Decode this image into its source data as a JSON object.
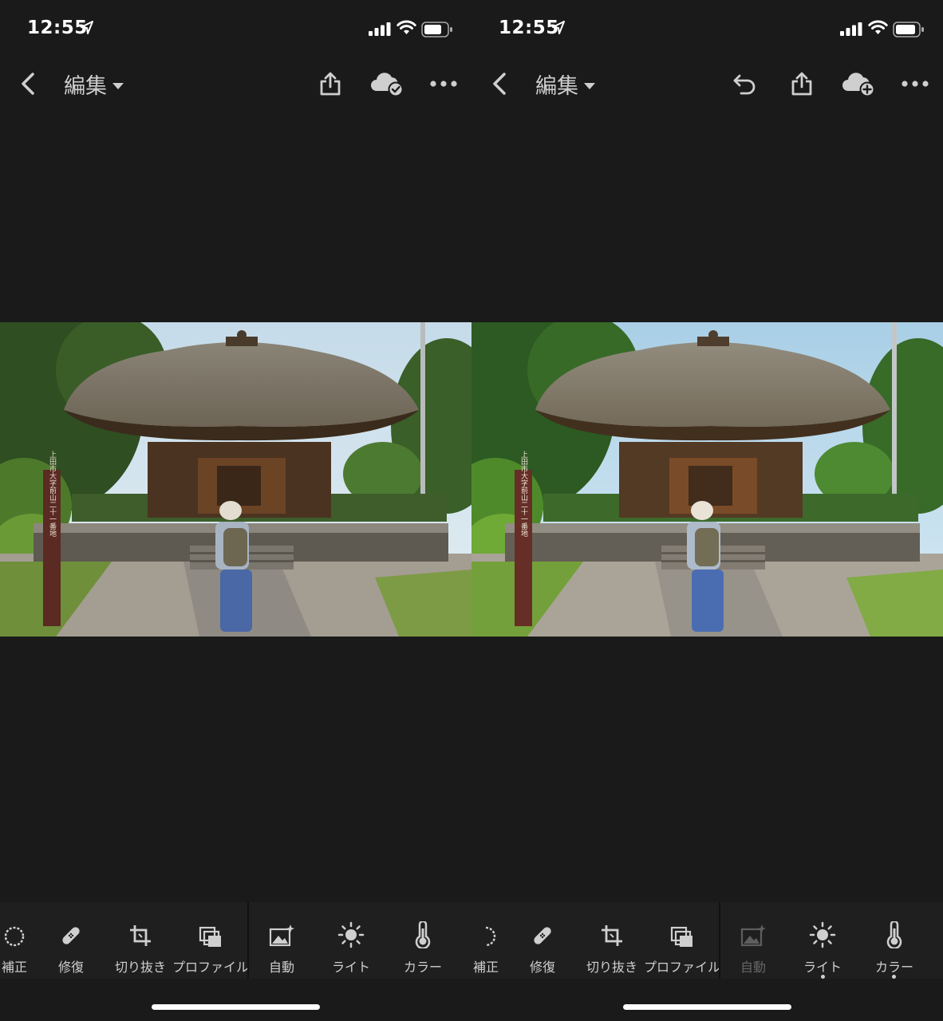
{
  "left": {
    "status": {
      "time": "12:55"
    },
    "nav": {
      "title": "編集"
    },
    "tools": [
      {
        "label": "補正"
      },
      {
        "label": "修復"
      },
      {
        "label": "切り抜き"
      },
      {
        "label": "プロファイル"
      },
      {
        "label": "自動"
      },
      {
        "label": "ライト"
      },
      {
        "label": "カラー"
      }
    ]
  },
  "right": {
    "status": {
      "time": "12:55"
    },
    "nav": {
      "title": "編集"
    },
    "tools": [
      {
        "label": "補正"
      },
      {
        "label": "修復"
      },
      {
        "label": "切り抜き"
      },
      {
        "label": "プロファイル"
      },
      {
        "label": "自動"
      },
      {
        "label": "ライト"
      },
      {
        "label": "カラー"
      }
    ]
  },
  "photo": {
    "sign_text": "上田市大字前山二十一番地"
  },
  "colors": {
    "background": "#1a1a1a",
    "toolbar": "#1f1f1f",
    "text": "#cfcfcf"
  }
}
